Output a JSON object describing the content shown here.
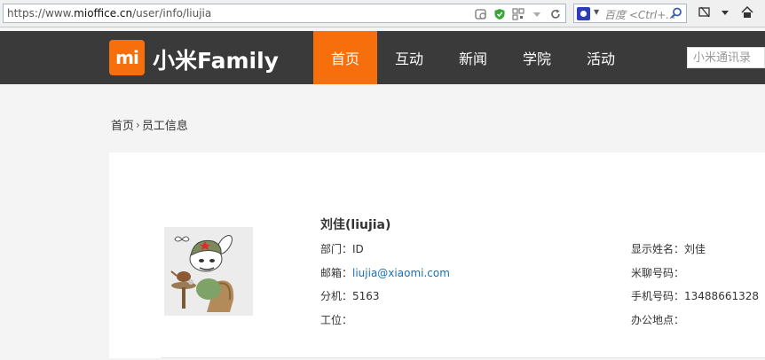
{
  "browser": {
    "url_prefix": "https://www.",
    "url_domain": "mioffice.cn",
    "url_path": "/user/info/liujia",
    "search_placeholder": "百度 <Ctrl+..."
  },
  "header": {
    "logo_text": "mi",
    "brand": "小米Family",
    "nav": [
      {
        "label": "首页",
        "active": true
      },
      {
        "label": "互动",
        "active": false
      },
      {
        "label": "新闻",
        "active": false
      },
      {
        "label": "学院",
        "active": false
      },
      {
        "label": "活动",
        "active": false
      }
    ],
    "contacts_search_placeholder": "小米通讯录"
  },
  "breadcrumb": {
    "home": "首页",
    "separator": "›",
    "current": "员工信息"
  },
  "employee": {
    "name": "刘佳(liujia)",
    "department_label": "部门：",
    "department": "ID",
    "email_label": "邮箱：",
    "email": "liujia@xiaomi.com",
    "extension_label": "分机：",
    "extension": "5163",
    "workstation_label": "工位：",
    "workstation": "",
    "display_name_label": "显示姓名：",
    "display_name": "刘佳",
    "michat_label": "米聊号码：",
    "michat": "",
    "mobile_label": "手机号码：",
    "mobile": "13488661328",
    "office_label": "办公地点：",
    "office": ""
  },
  "colors": {
    "accent": "#f76f0c",
    "header_bg": "#3a3a3a",
    "link": "#1a6fb5"
  }
}
